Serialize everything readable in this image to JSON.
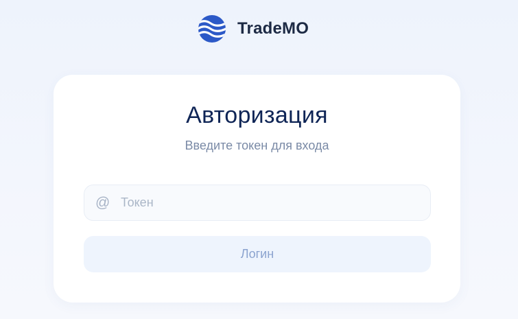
{
  "brand": {
    "name": "TradeMO",
    "logo_icon": "trademo-wave-logo-icon",
    "logo_color": "#2c59c7"
  },
  "login": {
    "title": "Авторизация",
    "subtitle": "Введите токен для входа",
    "token_field": {
      "icon": "at-sign-icon",
      "icon_glyph": "@",
      "placeholder": "Токен",
      "value": ""
    },
    "login_button_label": "Логин"
  },
  "colors": {
    "title": "#0f2556",
    "subtitle": "#7a8aa6",
    "button_bg": "#eef4fd",
    "button_text": "#8ba3cf"
  }
}
